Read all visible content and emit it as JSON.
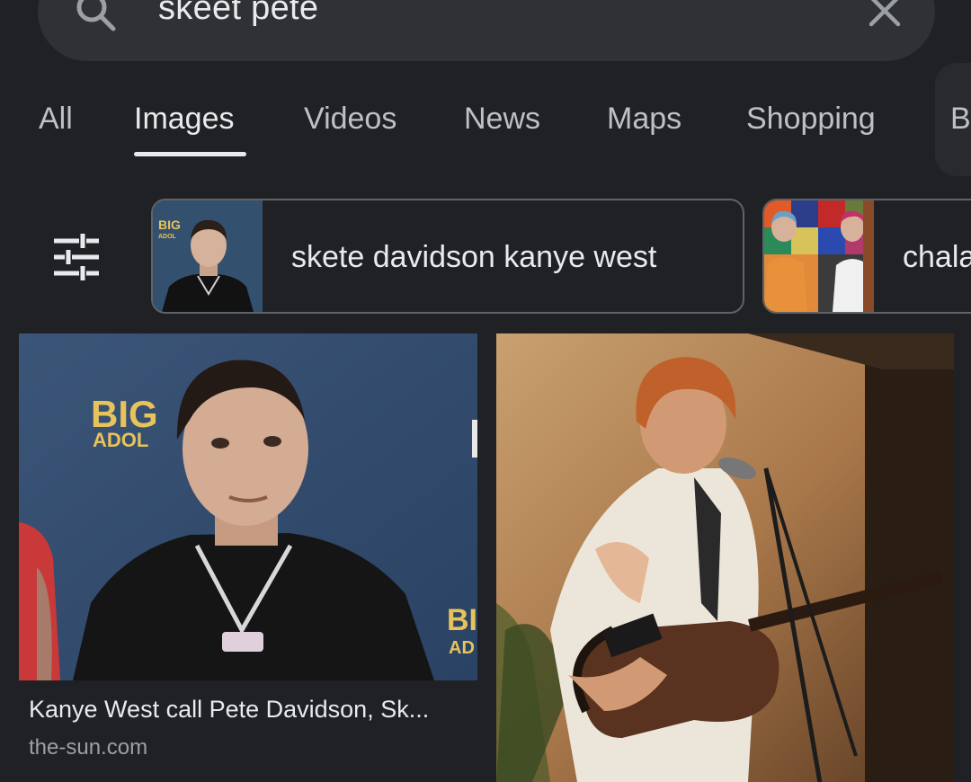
{
  "search": {
    "query": "skeet pete"
  },
  "tabs": [
    {
      "label": "All",
      "active": false
    },
    {
      "label": "Images",
      "active": true
    },
    {
      "label": "Videos",
      "active": false
    },
    {
      "label": "News",
      "active": false
    },
    {
      "label": "Maps",
      "active": false
    },
    {
      "label": "Shopping",
      "active": false
    },
    {
      "label": "B",
      "active": false
    }
  ],
  "chips": [
    {
      "label": "skete davidson kanye west",
      "thumb": "pete-davidson-photo"
    },
    {
      "label": "chala",
      "thumb": "snl-sketch-photo"
    }
  ],
  "results": [
    {
      "title": "Kanye West call Pete Davidson, Sk...",
      "source": "the-sun.com",
      "image": "pete-davidson-portrait",
      "backdrop_text": [
        "BIG",
        "ADOL",
        "BI",
        "AD"
      ]
    },
    {
      "image": "guitarist-performing-photo"
    }
  ],
  "icons": {
    "search": "search-icon",
    "clear": "close-icon",
    "filter": "tune-icon"
  },
  "colors": {
    "background": "#202124",
    "surface": "#303134",
    "text": "#e8eaed",
    "secondary_text": "#9aa0a6",
    "outline": "#5f6368"
  }
}
